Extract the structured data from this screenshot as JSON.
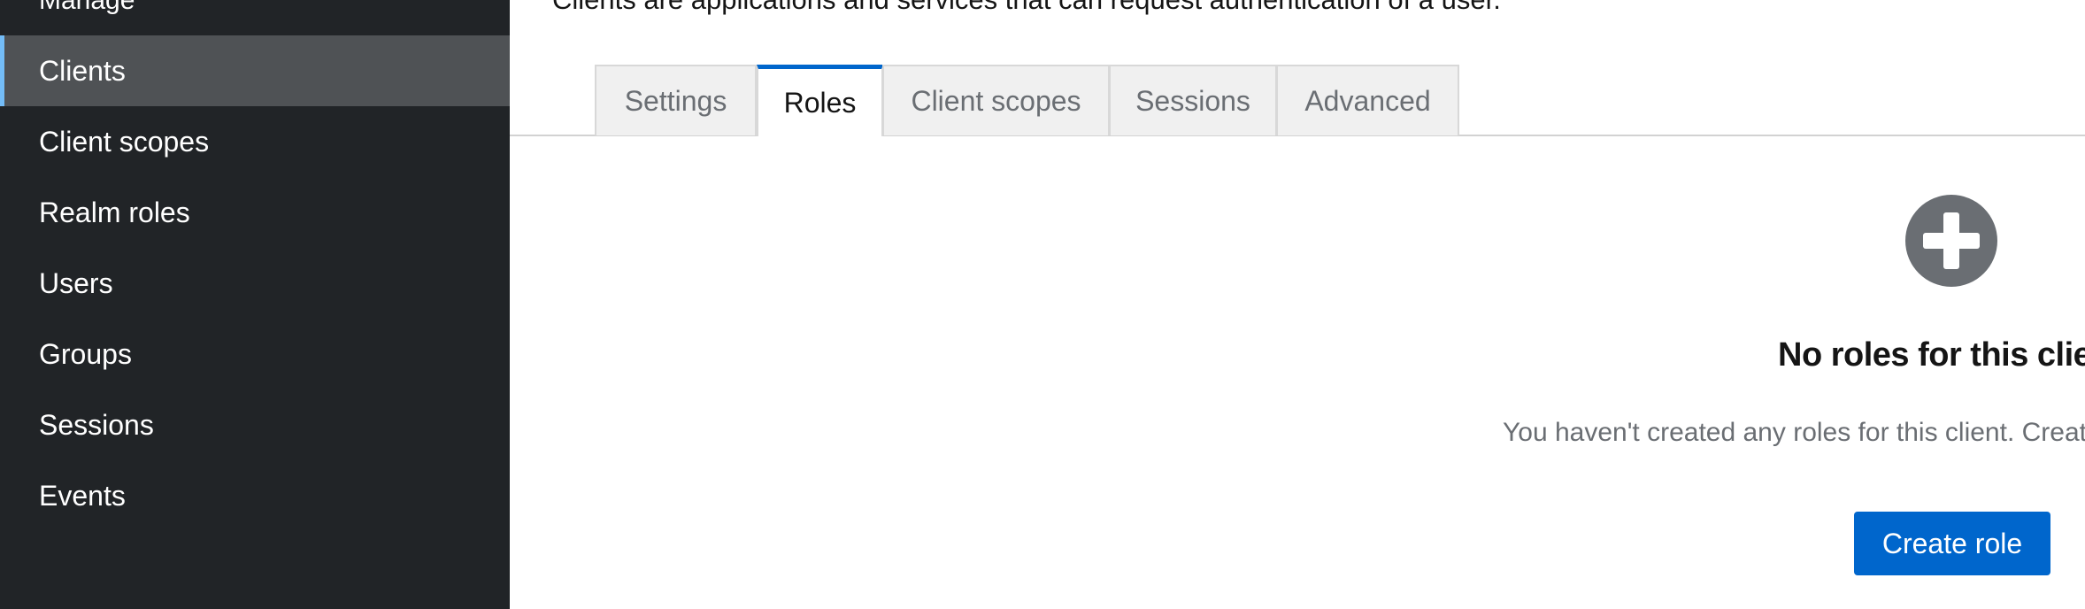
{
  "sidebar": {
    "section_title": "Manage",
    "items": [
      {
        "label": "Clients",
        "active": true
      },
      {
        "label": "Client scopes"
      },
      {
        "label": "Realm roles"
      },
      {
        "label": "Users"
      },
      {
        "label": "Groups"
      },
      {
        "label": "Sessions"
      },
      {
        "label": "Events"
      }
    ]
  },
  "main": {
    "description": "Clients are applications and services that can request authentication of a user.",
    "tabs": [
      {
        "label": "Settings"
      },
      {
        "label": "Roles",
        "active": true
      },
      {
        "label": "Client scopes"
      },
      {
        "label": "Sessions"
      },
      {
        "label": "Advanced"
      }
    ],
    "empty_state": {
      "icon": "plus-circle-icon",
      "title": "No roles for this client",
      "body": "You haven't created any roles for this client. Create a role to get started.",
      "button_label": "Create role"
    }
  },
  "colors": {
    "sidebar_bg": "#212427",
    "sidebar_active_bg": "#4f5255",
    "sidebar_active_accent": "#73bcf7",
    "primary": "#0066cc",
    "icon_gray": "#6a6e73"
  }
}
